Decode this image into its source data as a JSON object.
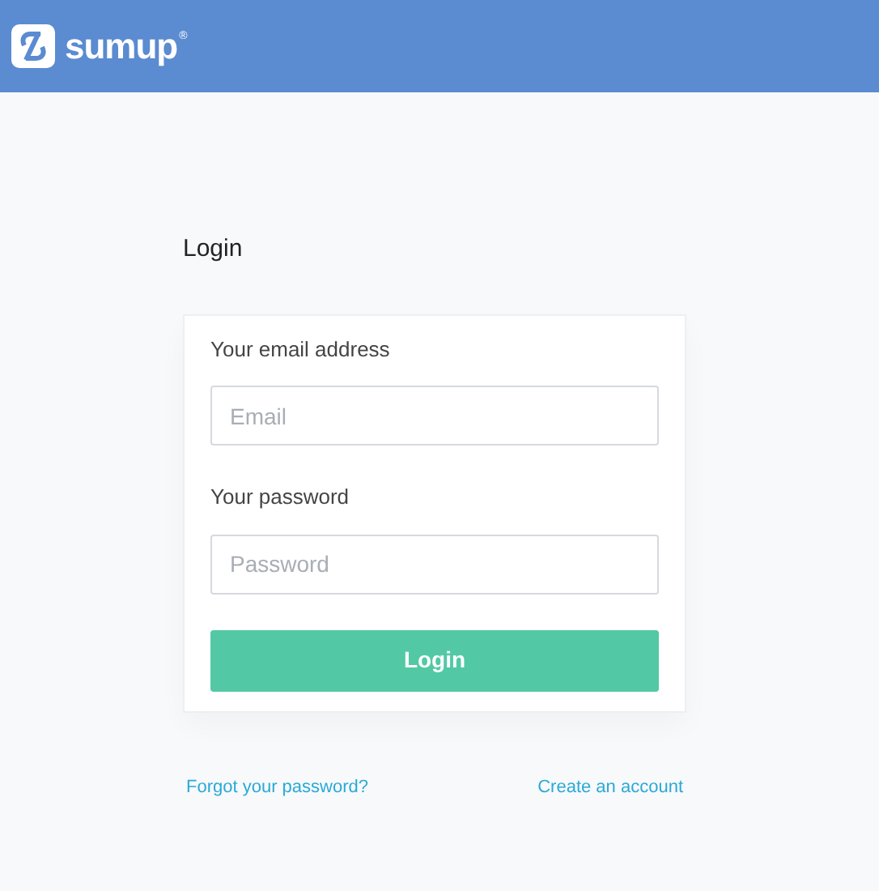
{
  "header": {
    "logo_text": "sumup",
    "logo_mark": "®"
  },
  "title": "Login",
  "form": {
    "fields": [
      {
        "label": "Your email address",
        "placeholder": "Email"
      },
      {
        "label": "Your password",
        "placeholder": "Password"
      }
    ],
    "submit": "Login"
  },
  "links": [
    "Forgot your password?",
    "Create an account"
  ]
}
